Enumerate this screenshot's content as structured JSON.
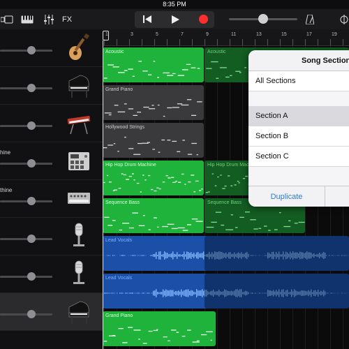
{
  "status": {
    "time": "8:35 PM"
  },
  "toolbar": {
    "fx_label": "FX",
    "rewind_icon": "skip-back-icon",
    "play_icon": "play-icon",
    "record_icon": "record-icon",
    "metronome_icon": "metronome-icon",
    "tracks_view_icon": "tracks-view-icon",
    "keyboard_icon": "keyboard-icon",
    "mixer_icon": "mixer-sliders-icon",
    "master_volume": 0.5
  },
  "ruler": {
    "bars": [
      "1",
      "3",
      "5",
      "7",
      "9",
      "11",
      "13",
      "15",
      "17",
      "19"
    ]
  },
  "tracks": [
    {
      "name": "",
      "instrument": "acoustic-guitar-icon",
      "volume": 0.6,
      "regions": [
        {
          "label": "Acoustic",
          "dim": false
        },
        {
          "label": "Acoustic",
          "dim": true
        }
      ]
    },
    {
      "name": "",
      "instrument": "grand-piano-icon",
      "volume": 0.6,
      "regions": [
        {
          "label": "Grand Piano",
          "dim": false
        }
      ]
    },
    {
      "name": "",
      "instrument": "keyboard-synth-icon",
      "volume": 0.6,
      "regions": [
        {
          "label": "Hollywood Strings",
          "dim": false
        }
      ]
    },
    {
      "name": "hine",
      "instrument": "drum-machine-icon",
      "volume": 0.6,
      "regions": [
        {
          "label": "Hip Hop Drum Machine",
          "dim": false
        },
        {
          "label": "Hip Hop Drum Machine",
          "dim": true
        }
      ]
    },
    {
      "name": "thine",
      "instrument": "synth-module-icon",
      "volume": 0.6,
      "regions": [
        {
          "label": "Sequence Bass",
          "dim": false
        },
        {
          "label": "Sequence Bass",
          "dim": true
        }
      ]
    },
    {
      "name": "",
      "instrument": "microphone-icon",
      "volume": 0.6,
      "regions": [
        {
          "label": "Lead Vocals",
          "dim": false
        }
      ]
    },
    {
      "name": "",
      "instrument": "microphone-icon",
      "volume": 0.6,
      "regions": [
        {
          "label": "Lead Vocals",
          "dim": false
        }
      ]
    },
    {
      "name": "",
      "instrument": "grand-piano-icon",
      "volume": 0.6,
      "regions": [
        {
          "label": "Grand Piano",
          "dim": false
        }
      ]
    }
  ],
  "popover": {
    "title": "Song Sections",
    "items": [
      "All Sections",
      "Section A",
      "Section B",
      "Section C"
    ],
    "selected_index": 1,
    "duplicate_label": "Duplicate"
  },
  "colors": {
    "region_green": "#1fb33c",
    "region_green_dim": "#135c22",
    "region_gray": "#3a3a3c",
    "region_blue": "#1b4fa8",
    "region_blue_dim": "#12356e",
    "record_red": "#ff2d2d",
    "link_blue": "#2b7cd3"
  }
}
